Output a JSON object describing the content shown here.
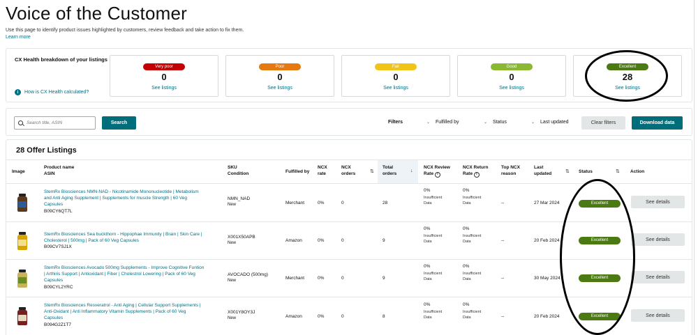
{
  "header": {
    "title": "Voice of the Customer",
    "description": "Use this page to identify product issues highlighted by customers, review feedback and take action to fix them.",
    "learn_more": "Learn more"
  },
  "cx_health": {
    "heading": "CX Health breakdown of your listings",
    "how_calculated": "How is CX Health calculated?",
    "cards": [
      {
        "label": "Very poor",
        "count": "0",
        "link": "See listings",
        "color": "#c40000"
      },
      {
        "label": "Poor",
        "count": "0",
        "link": "See listings",
        "color": "#e47911"
      },
      {
        "label": "Fair",
        "count": "0",
        "link": "See listings",
        "color": "#f0c419"
      },
      {
        "label": "Good",
        "count": "0",
        "link": "See listings",
        "color": "#8ab832"
      },
      {
        "label": "Excellent",
        "count": "28",
        "link": "See listings",
        "color": "#4b7a12"
      }
    ]
  },
  "filter_bar": {
    "search_placeholder": "Search title, ASIN",
    "search_button": "Search",
    "filters_label": "Filters",
    "fulfilled_by": "Fulfilled by",
    "status": "Status",
    "last_updated": "Last updated",
    "clear_filters": "Clear filters",
    "download_data": "Download data"
  },
  "listings": {
    "title": "28 Offer Listings",
    "columns": {
      "image": "Image",
      "product_name": "Product name",
      "asin": "ASIN",
      "sku": "SKU",
      "condition": "Condition",
      "fulfilled_by": "Fulfilled by",
      "ncx_rate_1": "NCX",
      "ncx_rate_2": "rate",
      "ncx_orders_1": "NCX",
      "ncx_orders_2": "orders",
      "total_orders_1": "Total",
      "total_orders_2": "orders",
      "review_rate_1": "NCX Review",
      "review_rate_2": "Rate",
      "return_rate_1": "NCX Return",
      "return_rate_2": "Rate",
      "top_reason_1": "Top NCX",
      "top_reason_2": "reason",
      "last_updated_1": "Last",
      "last_updated_2": "updated",
      "status": "Status",
      "action": "Action"
    },
    "rows": [
      {
        "name_1": "StemRx Biosciences NMN-NAD - Nicotinamide Mononucleotide | Metabolism",
        "name_2": "and Anti Aging Supplement | Supplements for muscle Strength | 60 Veg",
        "name_3": "Capsules",
        "asin": "B09CY6QT7L",
        "sku": "NMN_NAD",
        "condition": "New",
        "fulfilled_by": "Merchant",
        "ncx_rate": "0%",
        "ncx_orders": "0",
        "total_orders": "28",
        "review_rate": "0%",
        "return_rate": "0%",
        "insufficient_1": "Insufficient",
        "insufficient_2": "Data",
        "top_reason": "--",
        "last_updated": "27 Mar 2024",
        "status": "Excellent",
        "action": "See details"
      },
      {
        "name_1": "StemRx Biosciences Sea buckthorn - Hippophae Immunity | Brain | Skin Care |",
        "name_2": "Cholesterol | 500mg | Pack of 60 Veg Capsules",
        "name_3": "",
        "asin": "B09CV7SJ1X",
        "sku": "X001X50APB",
        "condition": "New",
        "fulfilled_by": "Amazon",
        "ncx_rate": "0%",
        "ncx_orders": "0",
        "total_orders": "9",
        "review_rate": "0%",
        "return_rate": "0%",
        "insufficient_1": "Insufficient",
        "insufficient_2": "Data",
        "top_reason": "--",
        "last_updated": "20 Feb 2024",
        "status": "Excellent",
        "action": "See details"
      },
      {
        "name_1": "StemRx Biosciences Avocado 500mg Supplements - Improve Cognitive Funtion",
        "name_2": "| Arthiris Support | Antioxidant | Fiber | Cholestrol Lowering | Pack of 60 Veg",
        "name_3": "Capsules",
        "asin": "B09CYL2YRC",
        "sku": "AVOCADO (500mg)",
        "condition": "New",
        "fulfilled_by": "Merchant",
        "ncx_rate": "0%",
        "ncx_orders": "0",
        "total_orders": "9",
        "review_rate": "0%",
        "return_rate": "0%",
        "insufficient_1": "Insufficient",
        "insufficient_2": "Data",
        "top_reason": "--",
        "last_updated": "30 May 2024",
        "status": "Excellent",
        "action": "See details"
      },
      {
        "name_1": "StemRx Biosciences Resveratrol - Anti Aging | Cellular Support Supplements |",
        "name_2": "Anti-Oxidant | Anti Inflammatory Vitamin Supplements | Pack of 60 Veg",
        "name_3": "Capsules",
        "asin": "B094G2Z1T7",
        "sku": "X001Y8OY3J",
        "condition": "New",
        "fulfilled_by": "Amazon",
        "ncx_rate": "0%",
        "ncx_orders": "0",
        "total_orders": "8",
        "review_rate": "0%",
        "return_rate": "0%",
        "insufficient_1": "Insufficient",
        "insufficient_2": "Data",
        "top_reason": "--",
        "last_updated": "20 Feb 2024",
        "status": "Excellent",
        "action": "See details"
      }
    ]
  }
}
